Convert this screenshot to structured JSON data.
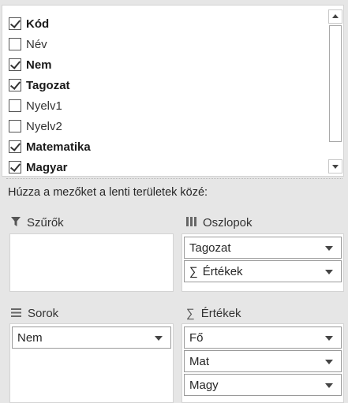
{
  "fields": [
    {
      "label": "Kód",
      "checked": true,
      "bold": true
    },
    {
      "label": "Név",
      "checked": false,
      "bold": false
    },
    {
      "label": "Nem",
      "checked": true,
      "bold": true
    },
    {
      "label": "Tagozat",
      "checked": true,
      "bold": true
    },
    {
      "label": "Nyelv1",
      "checked": false,
      "bold": false
    },
    {
      "label": "Nyelv2",
      "checked": false,
      "bold": false
    },
    {
      "label": "Matematika",
      "checked": true,
      "bold": true
    },
    {
      "label": "Magyar",
      "checked": true,
      "bold": true
    }
  ],
  "instruction": "Húzza a mezőket a lenti területek közé:",
  "areas": {
    "filters": {
      "title": "Szűrők",
      "icon": "filter-icon",
      "items": []
    },
    "columns": {
      "title": "Oszlopok",
      "icon": "columns-icon",
      "items": [
        "Tagozat",
        "Értékek"
      ]
    },
    "rows": {
      "title": "Sorok",
      "icon": "rows-icon",
      "items": [
        "Nem"
      ]
    },
    "values": {
      "title": "Értékek",
      "icon": "sigma-icon",
      "items": [
        "Fő",
        "Mat",
        "Magy"
      ]
    }
  },
  "sigma_symbol": "∑"
}
